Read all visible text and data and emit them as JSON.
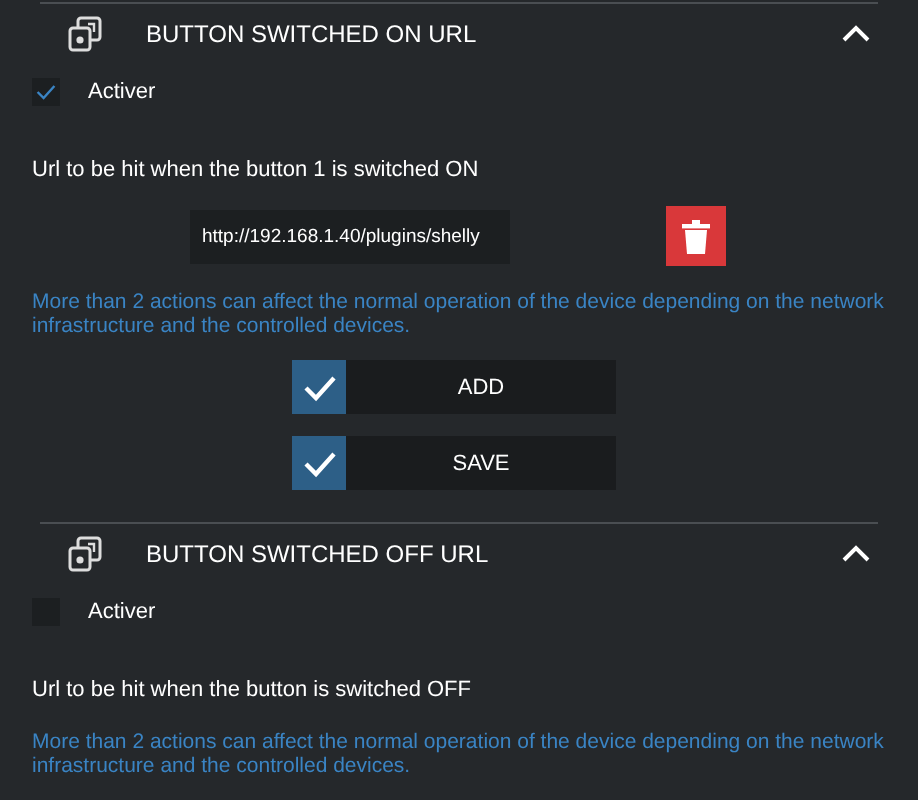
{
  "sections": [
    {
      "title": "BUTTON SWITCHED ON URL",
      "expanded": true,
      "enable": {
        "label": "Activer",
        "checked": true
      },
      "url_label": "Url to be hit when the button 1 is switched ON",
      "urls": [
        {
          "value": "http://192.168.1.40/plugins/shelly"
        }
      ],
      "warning": "More than 2 actions can affect the normal operation of the device depending on the network infrastructure and the controlled devices.",
      "buttons": [
        {
          "label": "ADD"
        },
        {
          "label": "SAVE"
        }
      ]
    },
    {
      "title": "BUTTON SWITCHED OFF URL",
      "expanded": true,
      "enable": {
        "label": "Activer",
        "checked": false
      },
      "url_label": "Url to be hit when the button is switched OFF",
      "warning": "More than 2 actions can affect the normal operation of the device depending on the network infrastructure and the controlled devices."
    }
  ]
}
